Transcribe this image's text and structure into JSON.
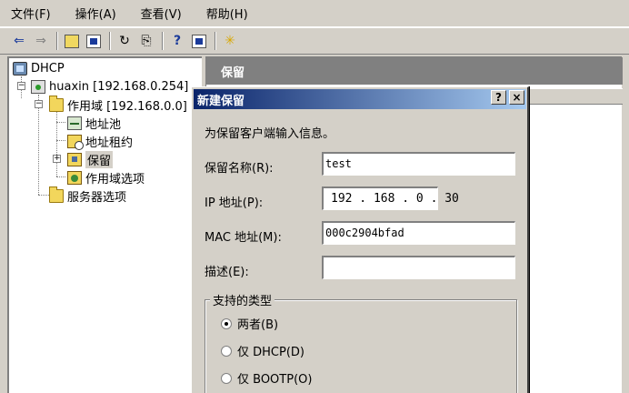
{
  "menu": [
    "文件(F)",
    "操作(A)",
    "查看(V)",
    "帮助(H)"
  ],
  "toolbar": {
    "back": "⇐",
    "forward": "⇒",
    "refresh": "↻",
    "export": "⎘",
    "help": "?",
    "star": "✳"
  },
  "tree": {
    "root": "DHCP",
    "server": "huaxin [192.168.0.254]",
    "scope": "作用域 [192.168.0.0]",
    "address_pool": "地址池",
    "address_leases": "地址租约",
    "reservations": "保留",
    "scope_options": "作用域选项",
    "server_options": "服务器选项"
  },
  "right_pane": {
    "header": "保留"
  },
  "dialog": {
    "title": "新建保留",
    "help_btn": "?",
    "close_btn": "×",
    "instruction": "为保留客户端输入信息。",
    "name_label": "保留名称(R):",
    "name_value": "test",
    "ip_label": "IP 地址(P):",
    "ip_value": "192 . 168 .  0 . 30",
    "mac_label": "MAC 地址(M):",
    "mac_value": "000c2904bfad",
    "desc_label": "描述(E):",
    "desc_value": "",
    "group_label": "支持的类型",
    "radio_both": "两者(B)",
    "radio_dhcp": "仅 DHCP(D)",
    "radio_bootp": "仅 BOOTP(O)",
    "selected": "both"
  }
}
